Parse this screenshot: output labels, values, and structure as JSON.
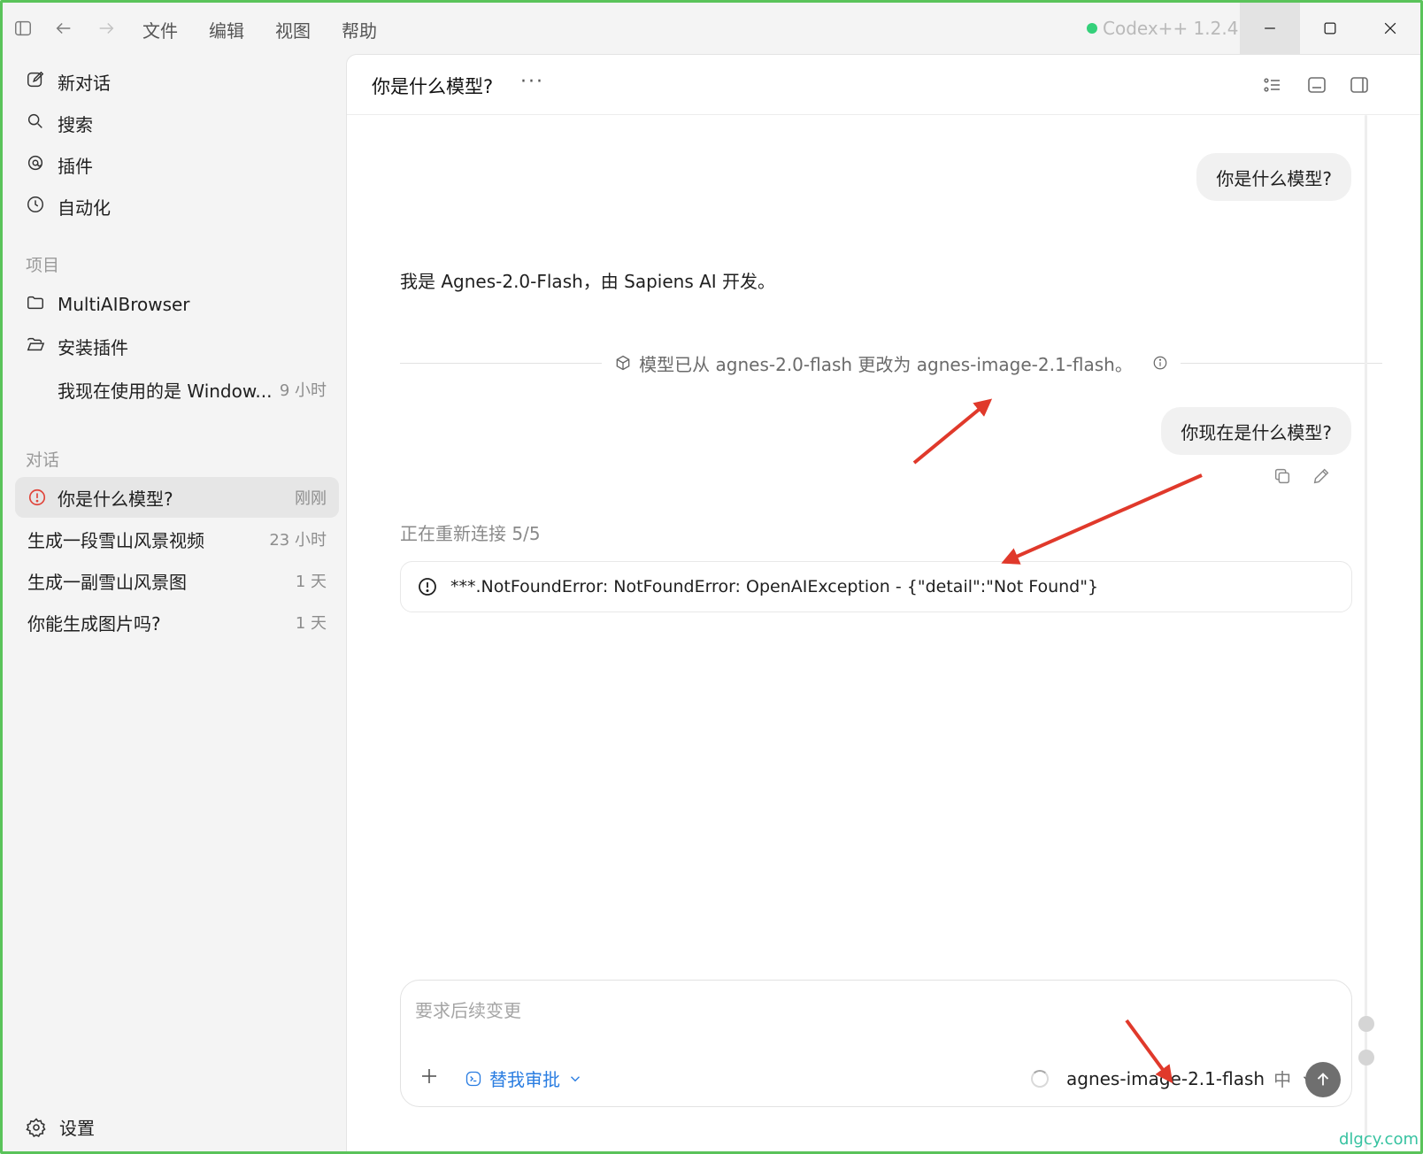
{
  "titlebar": {
    "menus": [
      "文件",
      "编辑",
      "视图",
      "帮助"
    ],
    "app_name": "Codex++ 1.2.4",
    "status_color": "#34d07a"
  },
  "sidebar": {
    "nav": [
      {
        "label": "新对话",
        "icon": "edit-icon"
      },
      {
        "label": "搜索",
        "icon": "search-icon"
      },
      {
        "label": "插件",
        "icon": "plugin-icon"
      },
      {
        "label": "自动化",
        "icon": "clock-icon"
      }
    ],
    "projects_label": "项目",
    "projects": [
      {
        "label": "MultiAIBrowser",
        "icon": "folder-icon"
      },
      {
        "label": "安装插件",
        "icon": "folder-open-icon"
      }
    ],
    "project_thread": {
      "title": "我现在使用的是 Window...",
      "time": "9 小时"
    },
    "conversations_label": "对话",
    "conversations": [
      {
        "title": "你是什么模型?",
        "time": "刚刚",
        "active": true
      },
      {
        "title": "生成一段雪山风景视频",
        "time": "23 小时"
      },
      {
        "title": "生成一副雪山风景图",
        "time": "1 天"
      },
      {
        "title": "你能生成图片吗?",
        "time": "1 天"
      }
    ],
    "settings_label": "设置"
  },
  "main": {
    "title": "你是什么模型?",
    "messages": {
      "user1": "你是什么模型?",
      "assistant1": "我是 Agnes-2.0-Flash，由 Sapiens AI 开发。",
      "model_change": "模型已从 agnes-2.0-flash 更改为 agnes-image-2.1-flash。",
      "user2": "你现在是什么模型?",
      "reconnect": "正在重新连接 5/5",
      "error": "***.NotFoundError: NotFoundError: OpenAIException - {\"detail\":\"Not Found\"}"
    },
    "composer": {
      "placeholder": "要求后续变更",
      "approve_label": "替我审批",
      "model": "agnes-image-2.1-flash",
      "effort": "中"
    }
  },
  "watermark": "dlgcy.com",
  "colors": {
    "accent": "#2a7de1",
    "error": "#e0443a",
    "annotation_arrow": "#e0392b",
    "frame": "#5ac35a"
  }
}
